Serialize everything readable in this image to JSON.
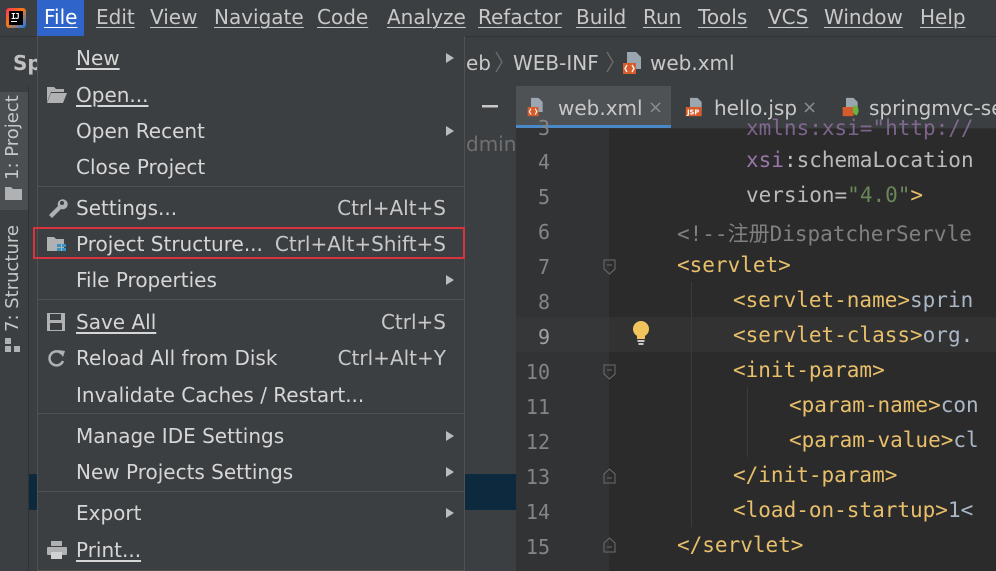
{
  "menubar": {
    "items": [
      {
        "label": "File",
        "active": true
      },
      {
        "label": "Edit"
      },
      {
        "label": "View"
      },
      {
        "label": "Navigate"
      },
      {
        "label": "Code"
      },
      {
        "label": "Analyze"
      },
      {
        "label": "Refactor"
      },
      {
        "label": "Build"
      },
      {
        "label": "Run"
      },
      {
        "label": "Tools"
      },
      {
        "label": "VCS"
      },
      {
        "label": "Window"
      },
      {
        "label": "Help"
      }
    ]
  },
  "navbar": {
    "project_partial": "Sp",
    "crumbs": [
      "eb",
      "WEB-INF",
      "web.xml"
    ]
  },
  "tool_windows": {
    "project": "1: Project",
    "structure": "7: Structure"
  },
  "sidebar": {
    "partial_text": "dmin"
  },
  "editor": {
    "tabs": [
      {
        "label": "web.xml",
        "active": true,
        "icon": "xml-file-icon"
      },
      {
        "label": "hello.jsp",
        "icon": "jsp-file-icon"
      },
      {
        "label": "springmvc-se",
        "icon": "spring-xml-icon"
      }
    ],
    "line_numbers": [
      "3",
      "4",
      "5",
      "6",
      "7",
      "8",
      "9",
      "10",
      "11",
      "12",
      "13",
      "14",
      "15"
    ],
    "current_line": "9",
    "code": {
      "l3_text": "xmlns:xsi=\"http://",
      "l4_ns": "xsi",
      "l4_attr": ":schemaLocation",
      "l5_attr": "version",
      "l5_eq": "=",
      "l5_val": "\"4.0\"",
      "l5_close": ">",
      "l6_comment": "<!--注册DispatcherServle",
      "l7_tag": "<servlet>",
      "l8_tag": "<servlet-name>",
      "l8_text": "sprin",
      "l9_tag": "<servlet-class>",
      "l9_text": "org.",
      "l10_tag": "<init-param>",
      "l11_tag": "<param-name>",
      "l11_text": "con",
      "l12_tag": "<param-value>",
      "l12_text": "cl",
      "l13_tag": "</init-param>",
      "l14_tag": "<load-on-startup>",
      "l14_text": "1<",
      "l15_tag": "</servlet>"
    }
  },
  "file_menu": {
    "new": {
      "label": "New"
    },
    "open": {
      "label": "Open..."
    },
    "open_recent": {
      "label": "Open Recent"
    },
    "close_project": {
      "label": "Close Project"
    },
    "settings": {
      "label": "Settings...",
      "shortcut": "Ctrl+Alt+S"
    },
    "project_structure": {
      "label": "Project Structure...",
      "shortcut": "Ctrl+Alt+Shift+S"
    },
    "file_properties": {
      "label": "File Properties"
    },
    "save_all": {
      "label": "Save All",
      "shortcut": "Ctrl+S"
    },
    "reload": {
      "label": "Reload All from Disk",
      "shortcut": "Ctrl+Alt+Y"
    },
    "invalidate": {
      "label": "Invalidate Caches / Restart..."
    },
    "manage_ide": {
      "label": "Manage IDE Settings"
    },
    "new_projects_settings": {
      "label": "New Projects Settings"
    },
    "export": {
      "label": "Export"
    },
    "print": {
      "label": "Print..."
    }
  },
  "colors": {
    "menu_active": "#2f65ca",
    "highlight_box": "#d9333f",
    "xml_tag": "#e8bf6a",
    "xml_string": "#6a8759"
  }
}
